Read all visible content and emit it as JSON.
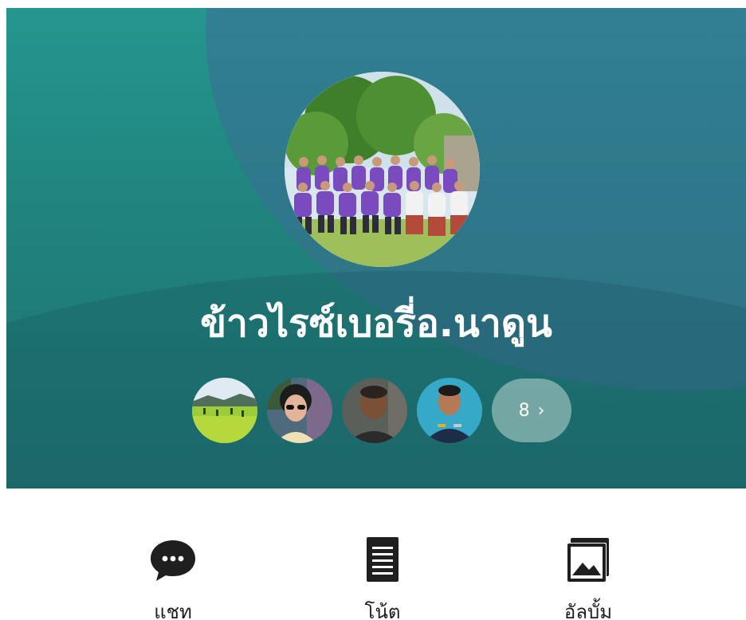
{
  "group": {
    "name": "ข้าวไรซ์เบอรี่อ.นาดูน"
  },
  "members": {
    "more_count": "8",
    "avatars": [
      "rice-field-avatar",
      "woman-sunglasses-avatar",
      "man-portrait-avatar",
      "officer-uniform-avatar"
    ]
  },
  "actions": {
    "chat_label": "แชท",
    "notes_label": "โน้ต",
    "album_label": "อัลบั้ม"
  },
  "colors": {
    "cover_teal": "#25968f",
    "icon_dark": "#1f1f1f"
  }
}
